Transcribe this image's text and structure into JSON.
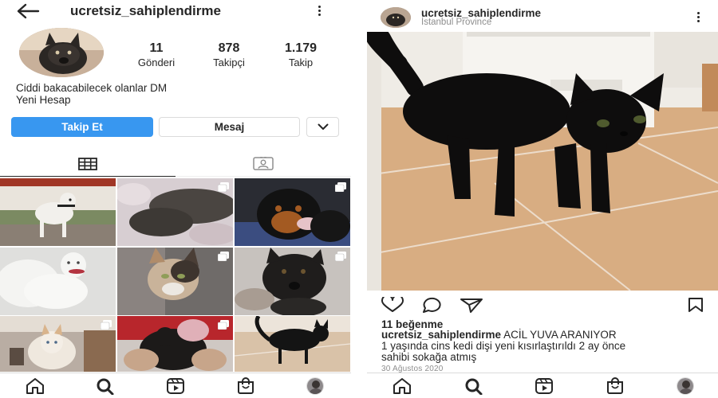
{
  "profile": {
    "username": "ucretsiz_sahiplendirme",
    "stats": [
      {
        "value": "11",
        "label": "Gönderi"
      },
      {
        "value": "878",
        "label": "Takipçi"
      },
      {
        "value": "1.179",
        "label": "Takip"
      }
    ],
    "bio_line1": "Ciddi bakacabilecek olanlar DM",
    "bio_line2": "Yeni Hesap",
    "follow_label": "Takip Et",
    "message_label": "Mesaj",
    "tabs": [
      "grid-icon",
      "tagged-icon"
    ],
    "grid_posts": [
      {
        "subject": "white dog in garden",
        "multi": false
      },
      {
        "subject": "sleeping cats",
        "multi": true
      },
      {
        "subject": "rottweiler puppy",
        "multi": true
      },
      {
        "subject": "white kitten",
        "multi": false
      },
      {
        "subject": "calico kitten",
        "multi": true
      },
      {
        "subject": "black puppy",
        "multi": true
      },
      {
        "subject": "cream cat",
        "multi": true
      },
      {
        "subject": "black puppy held",
        "multi": true
      },
      {
        "subject": "black cat",
        "multi": false
      }
    ]
  },
  "post": {
    "username": "ucretsiz_sahiplendirme",
    "location": "İstanbul Province",
    "likes": "11 beğenme",
    "caption_user": "ucretsiz_sahiplendirme",
    "caption_text": " ACİL YUVA ARANIYOR",
    "caption_line2": "1 yaşında cins kedi dişi yeni kısırlaştırıldı 2 ay önce",
    "caption_line3": "sahibi sokağa atmış",
    "date": "30 Ağustos 2020"
  },
  "nav_items": [
    "home-icon",
    "search-icon",
    "reels-icon",
    "shop-icon",
    "profile-avatar"
  ],
  "colors": {
    "accent": "#3897f0",
    "text": "#262626",
    "secondary": "#8e8e8e",
    "border": "#dbdbdb"
  }
}
